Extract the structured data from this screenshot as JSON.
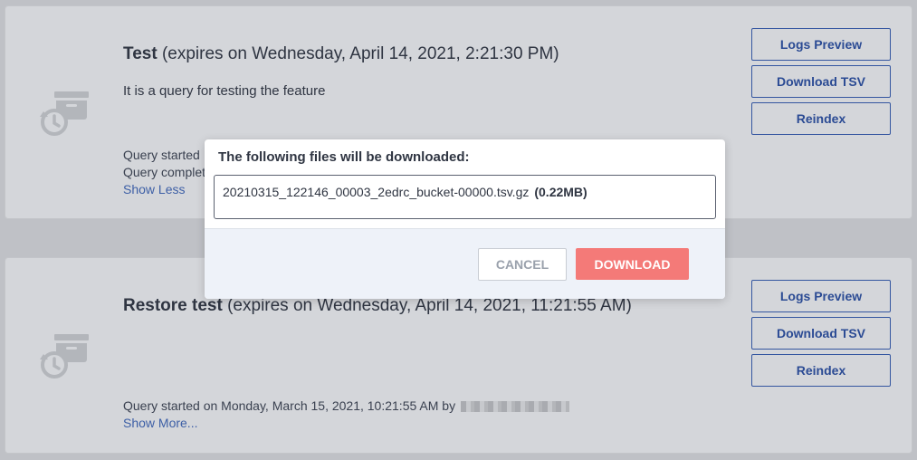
{
  "queries": [
    {
      "name": "Test",
      "expires": "(expires on Wednesday, April 14, 2021, 2:21:30 PM)",
      "description": "It is a query for testing the feature",
      "meta_started": "Query started",
      "meta_completed": "Query complet",
      "toggle_link": "Show Less",
      "icon": "restore-archive-icon"
    },
    {
      "name": "Restore test",
      "expires": "(expires on Wednesday, April 14, 2021, 11:21:55 AM)",
      "meta_started": "Query started on Monday, March 15, 2021, 10:21:55 AM by",
      "toggle_link": "Show More...",
      "icon": "restore-archive-icon"
    }
  ],
  "actions": {
    "logs_preview": "Logs Preview",
    "download_tsv": "Download TSV",
    "reindex": "Reindex"
  },
  "modal": {
    "title": "The following files will be downloaded:",
    "file_name": "20210315_122146_00003_2edrc_bucket-00000.tsv.gz",
    "file_size": "(0.22MB)",
    "cancel_label": "CANCEL",
    "download_label": "DOWNLOAD"
  },
  "colors": {
    "overlay": "#bfc1c6",
    "accent": "#2b4b94",
    "download_button": "#f47a78"
  }
}
